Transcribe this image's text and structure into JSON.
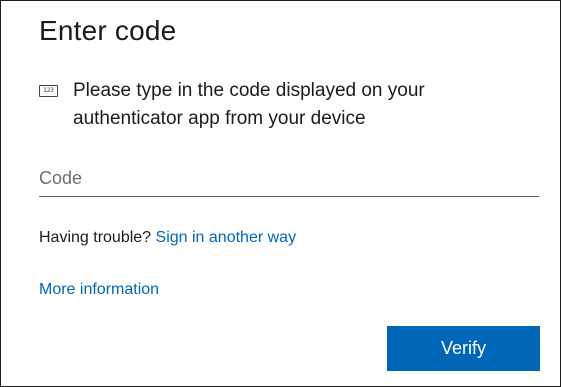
{
  "header": {
    "title": "Enter code"
  },
  "instruction": {
    "icon": "numeric-keypad-icon",
    "icon_text": "123",
    "text": "Please type in the code displayed on your authenticator app from your device"
  },
  "code_input": {
    "placeholder": "Code",
    "value": ""
  },
  "trouble": {
    "prefix": "Having trouble?",
    "link_label": "Sign in another way"
  },
  "more_info": {
    "label": "More information"
  },
  "verify": {
    "label": "Verify"
  },
  "colors": {
    "accent": "#0067b8",
    "text": "#1b1b1b"
  }
}
